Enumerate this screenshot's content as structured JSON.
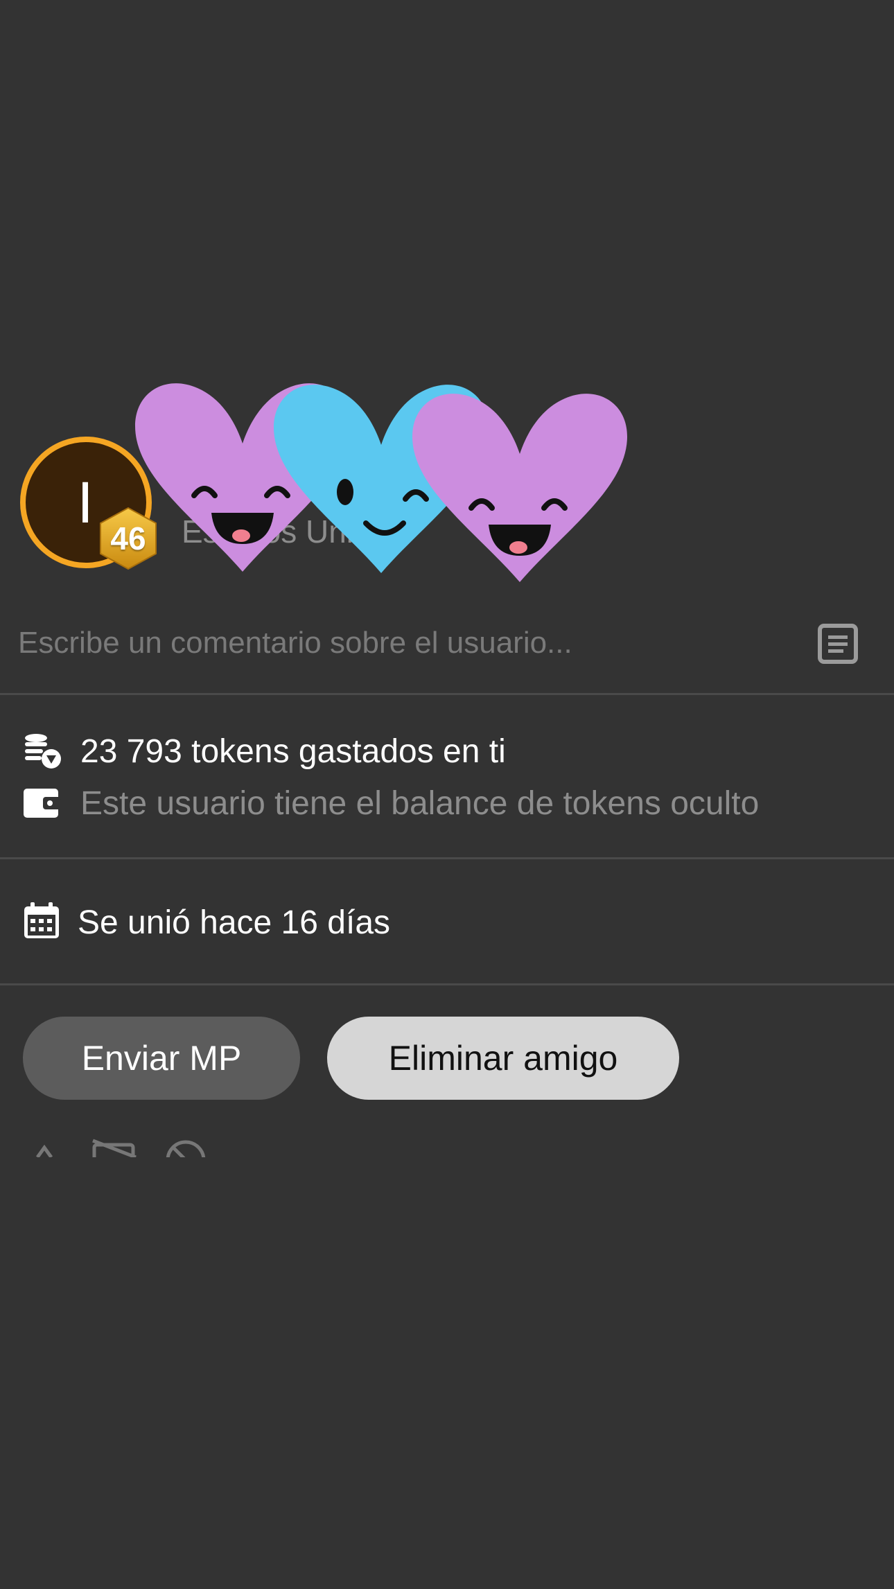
{
  "profile": {
    "avatar_initial": "I",
    "level": "46",
    "country": "Estados Unidos",
    "avatar_ring_color": "#f5a623",
    "avatar_bg_color": "#3a2208"
  },
  "hearts": [
    {
      "color": "#cc8ddf",
      "face": "laughing"
    },
    {
      "color": "#5bc8f0",
      "face": "winking"
    },
    {
      "color": "#cc8ddf",
      "face": "laughing"
    }
  ],
  "comment": {
    "placeholder": "Escribe un comentario sobre el usuario...",
    "value": "",
    "note_icon": "note-icon"
  },
  "tokens": {
    "spent_text": "23 793 tokens gastados en ti",
    "balance_text": "Este usuario tiene el balance de tokens oculto",
    "spent_icon": "coins-icon",
    "balance_icon": "wallet-icon"
  },
  "joined": {
    "text": "Se unió hace 16 días",
    "icon": "calendar-icon"
  },
  "actions": {
    "send_pm_label": "Enviar MP",
    "remove_friend_label": "Eliminar amigo"
  },
  "colors": {
    "background": "#333333",
    "divider": "#4a4a4a",
    "muted_text": "#8d8d8d",
    "secondary_button": "#5c5c5c",
    "primary_button": "#d6d6d6"
  }
}
